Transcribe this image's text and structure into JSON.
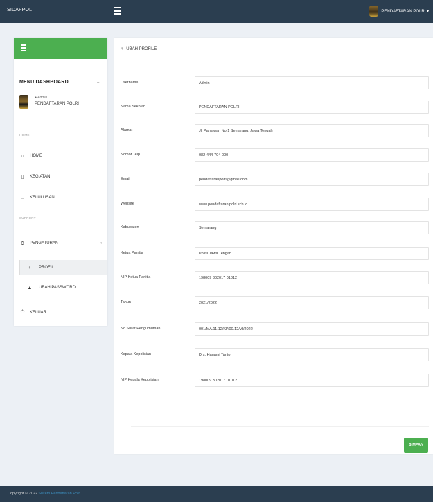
{
  "topbar": {
    "brand": "SIDAFPOL",
    "user_name": "PENDAFTARAN POLRI ▾"
  },
  "sidebar": {
    "menu_title": "MENU DASHBOARD",
    "menu_chevron": "⌄",
    "profile": {
      "role": "● Admin",
      "name": "PENDAFTARAN POLRI"
    },
    "section_home": "HOME",
    "section_support": "SUPPORT",
    "items": [
      {
        "label": "HOME",
        "icon": "circle-icon",
        "glyph": "○"
      },
      {
        "label": "KEGIATAN",
        "icon": "file-icon",
        "glyph": "▯"
      },
      {
        "label": "KELULUSAN",
        "icon": "square-icon",
        "glyph": "□"
      },
      {
        "label": "PENGATURAN",
        "icon": "gear-icon",
        "glyph": "⚙",
        "chevron": "‹"
      },
      {
        "label": "KELUAR",
        "icon": "power-icon",
        "glyph": "⏻"
      }
    ],
    "subitems": [
      {
        "label": "PROFIL",
        "icon": "user-icon",
        "glyph": "♀"
      },
      {
        "label": "UBAH PASSWORD",
        "icon": "lock-icon",
        "glyph": "▲"
      }
    ]
  },
  "main": {
    "title_icon": "♀",
    "title": "UBAH PROFILE",
    "fields": [
      {
        "label": "Username",
        "value": "Admin"
      },
      {
        "label": "Nama Sekolah",
        "value": "PENDAFTARAN POLRI"
      },
      {
        "label": "Alamat",
        "value": "Jl. Pahlawan No 1 Semarang, Jawa Tengah"
      },
      {
        "label": "Nomor Telp",
        "value": "082-444-704-000"
      },
      {
        "label": "Email",
        "value": "pendaftaranpolri@gmail.com"
      },
      {
        "label": "Website",
        "value": "www.pendaftaran.polri.sch.id"
      },
      {
        "label": "Kabupaten",
        "value": "Semarang"
      },
      {
        "label": "Ketua Panitia",
        "value": "Polisi Jawa Tengah"
      },
      {
        "label": "NIP Ketua Panitia",
        "value": "198009 302017 01012"
      },
      {
        "label": "Tahun",
        "value": "2021/2022"
      },
      {
        "label": "No Surat Pengumuman",
        "value": "001/MA.11.12/KP.00.12/VI/2022"
      },
      {
        "label": "Kepala Kepolisian",
        "value": "Drs. Hanami Tanto"
      },
      {
        "label": "NIP Kepala Kepolisian",
        "value": "198009 302017 01012"
      }
    ],
    "save_label": "SIMPAN"
  },
  "footer": {
    "copyright": "Copyright © 2022",
    "link": "Sistem Pendaftaran Polri"
  },
  "colors": {
    "header": "#2b3e50",
    "accent": "#4caf50",
    "link": "#3c8dbc"
  }
}
